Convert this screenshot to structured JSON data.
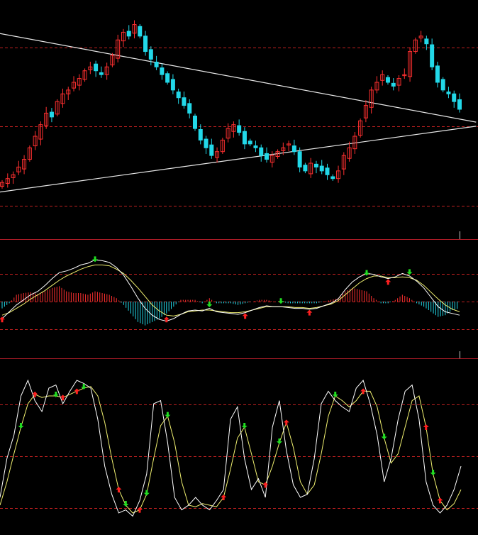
{
  "colors": {
    "background": "#000000",
    "up_candle": "#ff3030",
    "down_candle": "#22d8e8",
    "grid": "#c02020",
    "separator": "#b01c28",
    "trendline": "#e8e8e8",
    "fast_line": "#ffffff",
    "slow_line": "#f0f070",
    "hist_pos": "#ff3030",
    "hist_neg": "#22d8e8",
    "buy_arrow": "#ff2020",
    "sell_arrow": "#22dd22"
  },
  "chart_data": [
    {
      "type": "candlestick",
      "title": "",
      "trendlines": [
        {
          "from": [
            0,
            26.7
          ],
          "to": [
            84,
            4.2
          ]
        },
        {
          "from": [
            0,
            -14.5
          ],
          "to": [
            84,
            2.2
          ]
        }
      ],
      "closes": [
        -12,
        -11,
        -10,
        -8,
        -6,
        -3,
        0,
        3,
        6,
        5,
        9,
        11,
        12,
        14,
        15,
        17,
        18,
        17,
        16,
        18,
        21,
        25,
        27,
        26,
        29,
        26,
        22,
        20,
        18,
        16,
        14,
        12,
        10,
        8,
        6,
        2,
        -1,
        -3,
        -5,
        -4,
        -1,
        2,
        3,
        1,
        -2,
        -2,
        -3,
        -5,
        -6,
        -5,
        -4,
        -3,
        -2,
        -4,
        -8,
        -9,
        -7,
        -8,
        -9,
        -10,
        -11,
        -9,
        -5,
        -3,
        0,
        4,
        8,
        12,
        14,
        16,
        14,
        13,
        15,
        16,
        22,
        25,
        26,
        24,
        18,
        14,
        12,
        11,
        9,
        7
      ]
    },
    {
      "type": "macd",
      "title": "",
      "series": [
        {
          "role": "fast",
          "values": [
            -2.0,
            -1.2,
            -0.4,
            0.2,
            0.8,
            1.2,
            1.9,
            2.7,
            3.4,
            3.6,
            3.9,
            4.3,
            4.5,
            4.9,
            4.8,
            4.6,
            4.0,
            3.1,
            1.8,
            0.4,
            -0.8,
            -1.6,
            -2.1,
            -2.3,
            -2.0,
            -1.5,
            -1.1,
            -1.0,
            -1.1,
            -0.8,
            -1.2,
            -1.3,
            -1.4,
            -1.5,
            -1.3,
            -1.0,
            -0.7,
            -0.5,
            -0.6,
            -0.6,
            -0.7,
            -0.8,
            -0.8,
            -0.9,
            -0.8,
            -0.5,
            -0.2,
            0.3,
            1.4,
            2.3,
            2.9,
            3.3,
            3.2,
            2.9,
            2.7,
            2.9,
            3.3,
            3.0,
            2.4,
            1.6,
            0.5,
            -0.6,
            -1.2,
            -1.4,
            -1.6
          ]
        },
        {
          "role": "slow",
          "values": [
            -1.6,
            -1.3,
            -0.8,
            -0.3,
            0.3,
            0.8,
            1.3,
            1.9,
            2.5,
            3.0,
            3.4,
            3.8,
            4.1,
            4.3,
            4.3,
            4.2,
            3.8,
            3.3,
            2.5,
            1.6,
            0.6,
            -0.4,
            -1.1,
            -1.6,
            -1.7,
            -1.5,
            -1.2,
            -1.1,
            -1.0,
            -1.0,
            -1.1,
            -1.2,
            -1.3,
            -1.3,
            -1.2,
            -1.0,
            -0.8,
            -0.6,
            -0.6,
            -0.6,
            -0.6,
            -0.7,
            -0.7,
            -0.8,
            -0.7,
            -0.5,
            -0.3,
            0.1,
            0.8,
            1.5,
            2.2,
            2.7,
            3.0,
            3.0,
            2.8,
            2.8,
            2.9,
            2.8,
            2.5,
            1.9,
            1.1,
            0.3,
            -0.4,
            -0.9,
            -1.2
          ]
        }
      ],
      "histogram": [
        -0.8,
        -0.2,
        0.8,
        1.0,
        1.1,
        0.9,
        1.2,
        1.6,
        1.8,
        1.2,
        1.0,
        1.0,
        0.8,
        1.2,
        1.0,
        0.8,
        0.4,
        -0.4,
        -1.4,
        -2.4,
        -2.8,
        -2.4,
        -2.0,
        -1.4,
        -0.6,
        0.2,
        0.2,
        0.2,
        -0.2,
        0.4,
        -0.2,
        -0.2,
        -0.2,
        -0.4,
        -0.2,
        0.0,
        0.2,
        0.2,
        0.0,
        0.0,
        -0.2,
        -0.2,
        -0.2,
        -0.2,
        -0.2,
        0.0,
        0.2,
        0.4,
        1.2,
        1.6,
        1.4,
        1.2,
        0.4,
        -0.2,
        -0.2,
        0.2,
        0.8,
        0.4,
        -0.2,
        -0.6,
        -1.2,
        -1.8,
        -1.6,
        -1.0,
        -0.8
      ],
      "markers": [
        {
          "i": 0,
          "kind": "buy"
        },
        {
          "i": 13,
          "kind": "sell"
        },
        {
          "i": 23,
          "kind": "buy"
        },
        {
          "i": 29,
          "kind": "sell"
        },
        {
          "i": 34,
          "kind": "buy"
        },
        {
          "i": 39,
          "kind": "sell"
        },
        {
          "i": 43,
          "kind": "buy"
        },
        {
          "i": 51,
          "kind": "sell"
        },
        {
          "i": 54,
          "kind": "buy"
        },
        {
          "i": 57,
          "kind": "sell"
        }
      ]
    },
    {
      "type": "stochastic",
      "title": "",
      "series": [
        {
          "role": "K",
          "values": [
            20,
            45,
            60,
            85,
            95,
            82,
            75,
            90,
            92,
            80,
            88,
            95,
            93,
            90,
            70,
            40,
            22,
            10,
            12,
            8,
            18,
            35,
            80,
            82,
            55,
            20,
            12,
            15,
            20,
            15,
            12,
            18,
            25,
            70,
            78,
            45,
            25,
            32,
            20,
            65,
            82,
            50,
            28,
            20,
            22,
            45,
            80,
            88,
            82,
            78,
            75,
            90,
            95,
            80,
            60,
            30,
            45,
            70,
            88,
            92,
            70,
            30,
            15,
            10,
            15,
            25,
            40
          ]
        },
        {
          "role": "D",
          "values": [
            15,
            30,
            48,
            65,
            80,
            86,
            84,
            85,
            85,
            84,
            86,
            88,
            90,
            91,
            85,
            68,
            45,
            25,
            15,
            10,
            12,
            22,
            45,
            66,
            72,
            55,
            30,
            15,
            14,
            16,
            15,
            14,
            20,
            38,
            58,
            65,
            48,
            30,
            28,
            40,
            55,
            68,
            52,
            30,
            22,
            28,
            48,
            72,
            85,
            82,
            78,
            82,
            88,
            88,
            78,
            58,
            42,
            48,
            65,
            82,
            85,
            65,
            35,
            18,
            12,
            16,
            25
          ]
        }
      ],
      "markers": [
        {
          "i": 3,
          "kind": "sell"
        },
        {
          "i": 5,
          "kind": "buy"
        },
        {
          "i": 8,
          "kind": "sell"
        },
        {
          "i": 9,
          "kind": "buy"
        },
        {
          "i": 11,
          "kind": "buy"
        },
        {
          "i": 12,
          "kind": "sell"
        },
        {
          "i": 17,
          "kind": "buy"
        },
        {
          "i": 18,
          "kind": "sell"
        },
        {
          "i": 20,
          "kind": "buy"
        },
        {
          "i": 21,
          "kind": "sell"
        },
        {
          "i": 24,
          "kind": "sell"
        },
        {
          "i": 32,
          "kind": "buy"
        },
        {
          "i": 35,
          "kind": "sell"
        },
        {
          "i": 38,
          "kind": "buy"
        },
        {
          "i": 40,
          "kind": "sell"
        },
        {
          "i": 41,
          "kind": "buy"
        },
        {
          "i": 48,
          "kind": "sell"
        },
        {
          "i": 52,
          "kind": "buy"
        },
        {
          "i": 55,
          "kind": "sell"
        },
        {
          "i": 61,
          "kind": "buy"
        },
        {
          "i": 62,
          "kind": "sell"
        },
        {
          "i": 63,
          "kind": "buy"
        }
      ]
    }
  ]
}
